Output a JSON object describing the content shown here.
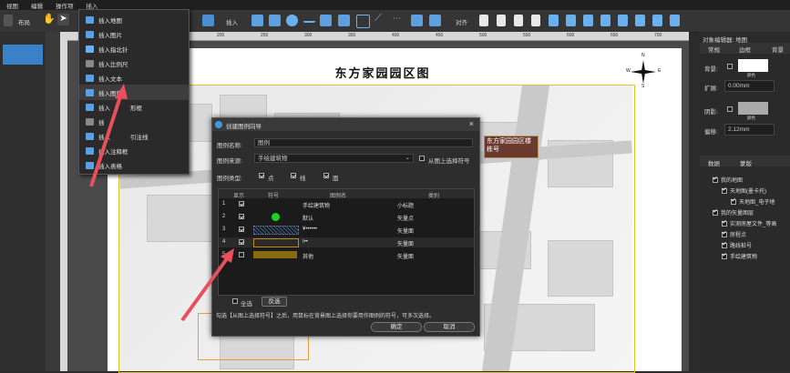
{
  "menubar": [
    "视图",
    "编辑",
    "操作项",
    "插入"
  ],
  "toolbar": {
    "layout_label": "布局",
    "insert_label": "插入",
    "align_label": "对齐"
  },
  "ruler_ticks": [
    "150",
    "200",
    "250",
    "300",
    "350",
    "400",
    "450",
    "500",
    "550",
    "600",
    "650",
    "700",
    "750",
    "800",
    "850"
  ],
  "insert_menu": [
    {
      "label": "插入地图",
      "icon": "map-icon"
    },
    {
      "label": "插入图片",
      "icon": "image-icon"
    },
    {
      "label": "插入指北针",
      "icon": "compass-icon"
    },
    {
      "label": "插入比例尺",
      "icon": "scale-bar-icon"
    },
    {
      "label": "插入文本",
      "icon": "text-icon"
    },
    {
      "label": "插入图例",
      "icon": "legend-icon"
    },
    {
      "label": "插入",
      "icon": "frame-icon",
      "suffix": "形框"
    },
    {
      "label": "插",
      "icon": "line-icon"
    },
    {
      "label": "插入",
      "icon": "leader-line-icon",
      "suffix": "引注线"
    },
    {
      "label": "插入注释框",
      "icon": "note-box-icon"
    },
    {
      "label": "插入表格",
      "icon": "table-icon"
    }
  ],
  "map": {
    "title": "东方家园园区图",
    "callout": "东方家园园区楼栋号",
    "compass_letters": {
      "n": "N",
      "s": "S",
      "e": "E",
      "w": "W"
    }
  },
  "dialog": {
    "title": "创建图例向导",
    "name_label": "图例名称:",
    "name_value": "图例",
    "source_label": "图例来源:",
    "source_value": "手绘建筑物",
    "from_bg_label": "从图上选择符号",
    "type_label": "图例类型:",
    "types": [
      {
        "label": "点",
        "checked": true
      },
      {
        "label": "线",
        "checked": true
      },
      {
        "label": "面",
        "checked": true
      }
    ],
    "columns": [
      "显示",
      "符号",
      "图例名",
      "类别"
    ],
    "rows": [
      {
        "num": "1",
        "checked": true,
        "symbol": "none",
        "name": "手绘建筑物",
        "category": "小标题",
        "symbol_color": ""
      },
      {
        "num": "2",
        "checked": true,
        "symbol": "dot",
        "name": "默认",
        "category": "矢量点",
        "symbol_color": "#1fd11f"
      },
      {
        "num": "3",
        "checked": true,
        "symbol": "hatch",
        "name": "¥••••••",
        "category": "矢量面",
        "symbol_color": "#3a5a8a"
      },
      {
        "num": "4",
        "checked": true,
        "symbol": "box",
        "name": "I••",
        "category": "矢量面",
        "symbol_color": "#c08a1a"
      },
      {
        "num": "5",
        "checked": false,
        "symbol": "fill",
        "name": "其他",
        "category": "矢量面",
        "symbol_color": "#8a6a10"
      }
    ],
    "select_all_label": "全选",
    "invert_label": "反选",
    "hint": "勾选【从图上选择符号】之后，用鼠标在背景图上选择你要用作图例的符号，可多次选择。",
    "ok_label": "确定",
    "cancel_label": "取消"
  },
  "right_panel": {
    "header": "对象编辑器: 地图",
    "tabs": [
      "常规",
      "边框",
      "背景"
    ],
    "bg_label": "背景:",
    "expand_label": "扩展:",
    "expand_value": "0.00mm",
    "shadow_label": "阴影:",
    "offset_label": "偏移:",
    "offset_value": "2.12mm",
    "color_caption": "颜色",
    "color_caption2": "颜色",
    "tabs2": [
      "数据",
      "蒙版"
    ],
    "tree": [
      {
        "label": "我的地图",
        "level": 0,
        "checked": true
      },
      {
        "label": "天地图(墨卡托)",
        "level": 1,
        "checked": true
      },
      {
        "label": "天地图_电子地",
        "level": 2,
        "checked": true
      },
      {
        "label": "我的矢量图层",
        "level": 0,
        "checked": true
      },
      {
        "label": "实测房屋文件_等高",
        "level": 1,
        "checked": true
      },
      {
        "label": "房程点",
        "level": 1,
        "checked": true
      },
      {
        "label": "路线桩号",
        "level": 1,
        "checked": true
      },
      {
        "label": "手绘建筑物",
        "level": 1,
        "checked": true
      }
    ]
  },
  "colors": {
    "accent": "#3c9be0",
    "arrow": "#e8505b",
    "frame": "#e4c22a"
  }
}
